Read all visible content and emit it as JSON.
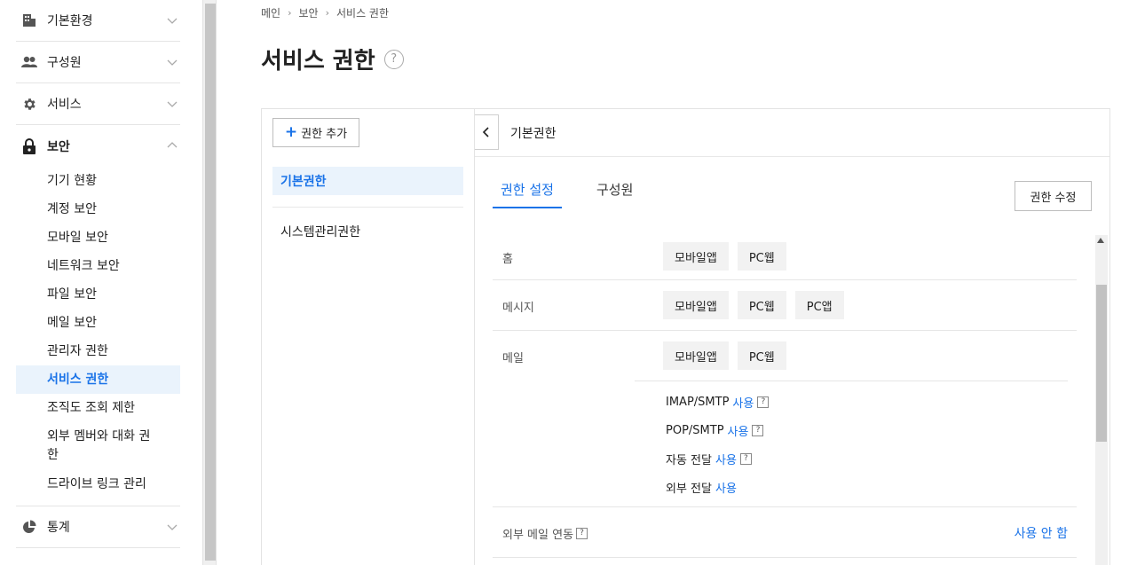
{
  "sidebar": {
    "groups_top": [
      {
        "label": "기본환경",
        "icon": "building-icon"
      },
      {
        "label": "구성원",
        "icon": "users-icon"
      },
      {
        "label": "서비스",
        "icon": "gear-icon"
      }
    ],
    "security": {
      "label": "보안",
      "icon": "lock-icon",
      "items": [
        "기기 현황",
        "계정 보안",
        "모바일 보안",
        "네트워크 보안",
        "파일 보안",
        "메일 보안",
        "관리자 권한",
        "서비스 권한",
        "조직도 조회 제한",
        "외부 멤버와 대화 권한",
        "드라이브 링크 관리"
      ],
      "active_index": 7
    },
    "stats": {
      "label": "통계",
      "icon": "pie-chart-icon"
    }
  },
  "breadcrumb": [
    "메인",
    "보안",
    "서비스 권한"
  ],
  "page_title": "서비스 권한",
  "left_panel": {
    "add_label": "권한 추가",
    "roles": [
      "기본권한",
      "시스템관리권한"
    ]
  },
  "right_panel": {
    "title": "기본권한",
    "tabs": [
      "권한 설정",
      "구성원"
    ],
    "edit_label": "권한 수정",
    "rows": {
      "home": {
        "label": "홈",
        "chips": [
          "모바일앱",
          "PC웹"
        ]
      },
      "message": {
        "label": "메시지",
        "chips": [
          "모바일앱",
          "PC웹",
          "PC앱"
        ]
      },
      "mail": {
        "label": "메일",
        "chips": [
          "모바일앱",
          "PC웹"
        ],
        "options": [
          {
            "name": "IMAP/SMTP",
            "value": "사용"
          },
          {
            "name": "POP/SMTP",
            "value": "사용"
          },
          {
            "name": "자동 전달",
            "value": "사용"
          },
          {
            "name": "외부 전달",
            "value": "사용"
          }
        ]
      },
      "ext_mail": {
        "label": "외부 메일 연동",
        "value": "사용 안 함"
      }
    }
  },
  "help_glyph": "?",
  "colors": {
    "accent": "#1a73e8",
    "active_bg": "#eaf3fc"
  }
}
